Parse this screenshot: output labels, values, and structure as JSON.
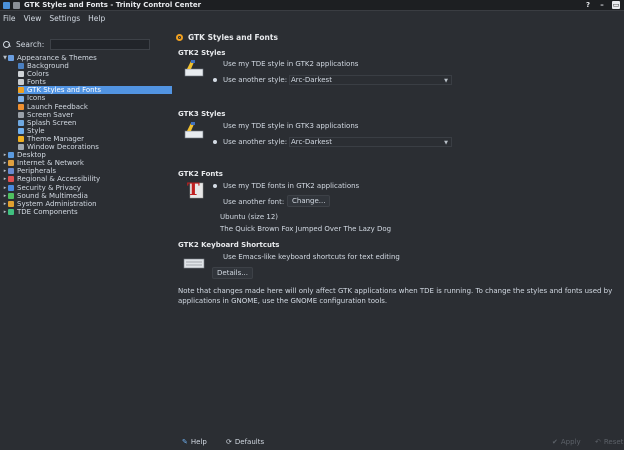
{
  "window": {
    "title": "GTK Styles and Fonts - Trinity Control Center",
    "controls": [
      "?",
      "–",
      "▭"
    ]
  },
  "menu": [
    "File",
    "View",
    "Settings",
    "Help"
  ],
  "search": {
    "label": "Search:",
    "value": ""
  },
  "tree": [
    {
      "label": "Appearance & Themes",
      "expanded": true,
      "icon": "appearance-icon",
      "color": "#6a9ee0"
    },
    {
      "label": "Background",
      "child": true,
      "icon": "background-icon",
      "color": "#4a7fc0"
    },
    {
      "label": "Colors",
      "child": true,
      "icon": "colors-icon",
      "color": "#d0d4d8"
    },
    {
      "label": "Fonts",
      "child": true,
      "icon": "fonts-icon",
      "color": "#c8ccd0"
    },
    {
      "label": "GTK Styles and Fonts",
      "child": true,
      "selected": true,
      "icon": "gtk-icon",
      "color": "#f0a020"
    },
    {
      "label": "Icons",
      "child": true,
      "icon": "icons-icon",
      "color": "#7fb0e8"
    },
    {
      "label": "Launch Feedback",
      "child": true,
      "icon": "launch-feedback-icon",
      "color": "#f09030"
    },
    {
      "label": "Screen Saver",
      "child": true,
      "icon": "screen-saver-icon",
      "color": "#9aa0a8"
    },
    {
      "label": "Splash Screen",
      "child": true,
      "icon": "splash-screen-icon",
      "color": "#6fa8e0"
    },
    {
      "label": "Style",
      "child": true,
      "icon": "style-icon",
      "color": "#6fb0f0"
    },
    {
      "label": "Theme Manager",
      "child": true,
      "icon": "theme-manager-icon",
      "color": "#f0b020"
    },
    {
      "label": "Window Decorations",
      "child": true,
      "icon": "window-decorations-icon",
      "color": "#a0a8b0"
    },
    {
      "label": "Desktop",
      "icon": "desktop-icon",
      "color": "#5a9ae0"
    },
    {
      "label": "Internet & Network",
      "icon": "internet-icon",
      "color": "#e0a040"
    },
    {
      "label": "Peripherals",
      "icon": "peripherals-icon",
      "color": "#6a8ad0"
    },
    {
      "label": "Regional & Accessibility",
      "icon": "regional-icon",
      "color": "#e05050"
    },
    {
      "label": "Security & Privacy",
      "icon": "security-icon",
      "color": "#4a8ae0"
    },
    {
      "label": "Sound & Multimedia",
      "icon": "sound-icon",
      "color": "#50c060"
    },
    {
      "label": "System Administration",
      "icon": "system-admin-icon",
      "color": "#e0a030"
    },
    {
      "label": "TDE Components",
      "icon": "tde-components-icon",
      "color": "#40c080"
    }
  ],
  "page": {
    "title": "GTK Styles and Fonts",
    "gtk2_styles": {
      "title": "GTK2 Styles",
      "option_tde": "Use my TDE style in GTK2 applications",
      "option_other": "Use another style:",
      "selected_style": "Arc-Darkest"
    },
    "gtk3_styles": {
      "title": "GTK3 Styles",
      "option_tde": "Use my TDE style in GTK3 applications",
      "option_other": "Use another style:",
      "selected_style": "Arc-Darkest"
    },
    "gtk2_fonts": {
      "title": "GTK2 Fonts",
      "option_tde": "Use my TDE fonts in GTK2 applications",
      "option_other": "Use another font:",
      "change_button": "Change...",
      "font_name": "Ubuntu (size 12)",
      "sample": "The Quick Brown Fox Jumped Over The Lazy Dog"
    },
    "gtk2_shortcuts": {
      "title": "GTK2 Keyboard Shortcuts",
      "option_emacs": "Use Emacs-like keyboard shortcuts for text editing",
      "details_button": "Details..."
    },
    "note": "Note that changes made here will only affect GTK applications when TDE is running.  To change the styles and fonts used by applications in GNOME, use the GNOME configuration tools."
  },
  "bottom": {
    "help": "Help",
    "defaults": "Defaults",
    "apply": "Apply",
    "reset": "Reset"
  },
  "colors": {
    "accent": "#5294e2",
    "background": "#2b2e33",
    "text": "#d3dae3"
  }
}
